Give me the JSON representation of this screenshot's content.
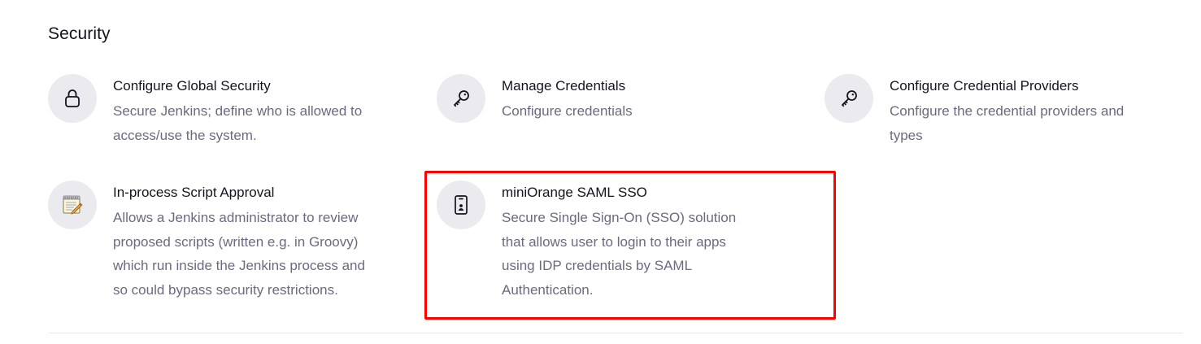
{
  "section": {
    "title": "Security"
  },
  "items": [
    {
      "title": "Configure Global Security",
      "desc_lines": [
        "Secure Jenkins; define who is allowed to",
        "access/use the system."
      ],
      "icon": "lock-icon"
    },
    {
      "title": "Manage Credentials",
      "desc_lines": [
        "Configure credentials"
      ],
      "icon": "key-icon"
    },
    {
      "title": "Configure Credential Providers",
      "desc_lines": [
        "Configure the credential providers and",
        "types"
      ],
      "icon": "key-icon"
    },
    {
      "title": "In-process Script Approval",
      "desc_lines": [
        "Allows a Jenkins administrator to review",
        "proposed scripts (written e.g. in Groovy)",
        "which run inside the Jenkins process and",
        "so could bypass security restrictions."
      ],
      "icon": "notepad-icon"
    },
    {
      "title": "miniOrange SAML SSO",
      "desc_lines": [
        "Secure Single Sign-On (SSO) solution",
        "that allows user to login to their apps",
        "using IDP credentials by SAML",
        "Authentication."
      ],
      "icon": "mobile-badge-icon"
    }
  ],
  "colors": {
    "title_text": "#14141f",
    "desc_text": "#6a6a80",
    "icon_bg": "#eaeaef",
    "highlight": "#ff0000"
  }
}
